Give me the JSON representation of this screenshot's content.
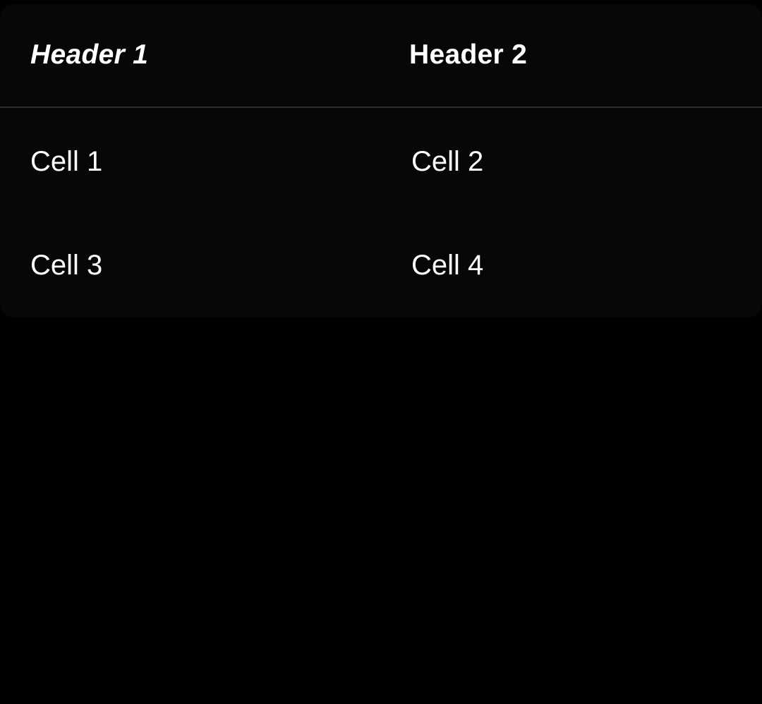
{
  "table": {
    "headers": [
      "Header 1",
      "Header 2"
    ],
    "rows": [
      [
        "Cell 1",
        "Cell 2"
      ],
      [
        "Cell 3",
        "Cell 4"
      ]
    ]
  },
  "colors": {
    "page_background": "#000000",
    "card_background": "#070707",
    "divider": "#2a2a2a",
    "text": "#ffffff"
  }
}
